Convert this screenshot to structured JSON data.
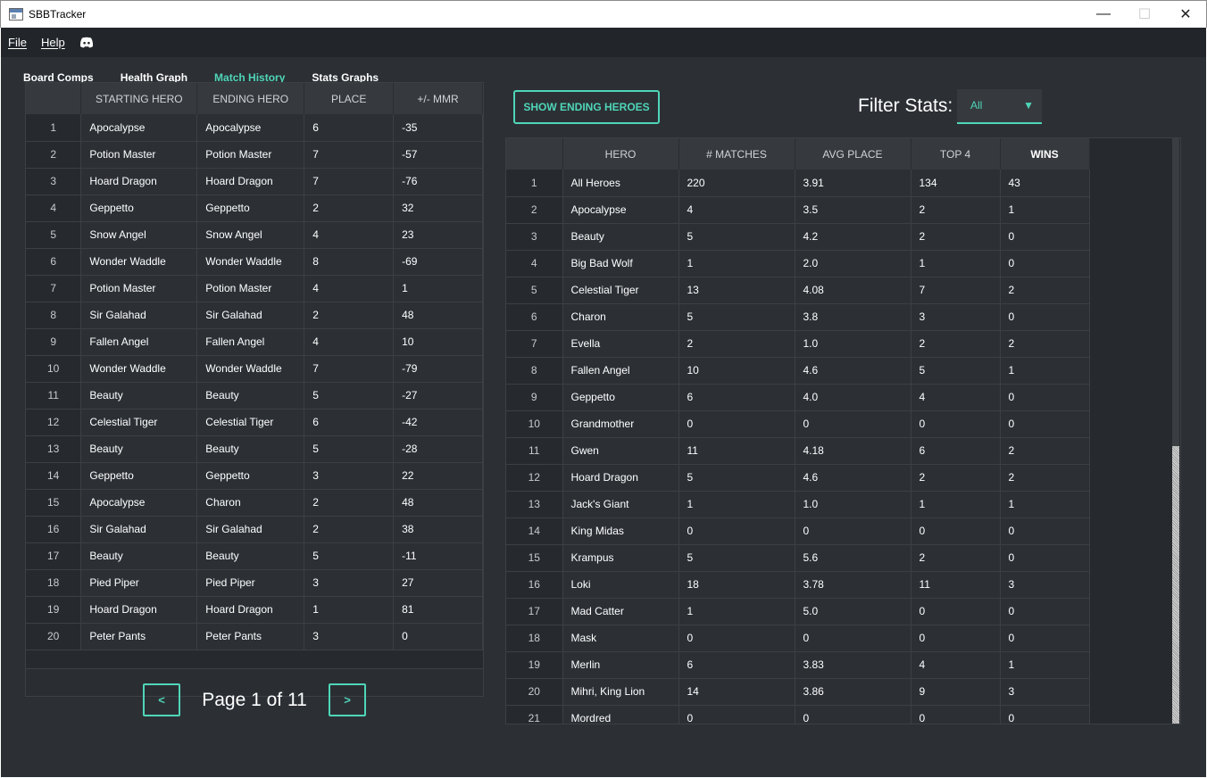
{
  "window": {
    "title": "SBBTracker",
    "min": "—",
    "max": "☐",
    "close": "✕"
  },
  "menu": {
    "file": "File",
    "help": "Help"
  },
  "tabs": [
    "Board Comps",
    "Health Graph",
    "Match History",
    "Stats Graphs"
  ],
  "match_history": {
    "columns": [
      "STARTING HERO",
      "ENDING HERO",
      "PLACE",
      "+/- MMR"
    ],
    "rows": [
      [
        "1",
        "Apocalypse",
        "Apocalypse",
        "6",
        "-35"
      ],
      [
        "2",
        "Potion Master",
        "Potion Master",
        "7",
        "-57"
      ],
      [
        "3",
        "Hoard Dragon",
        "Hoard Dragon",
        "7",
        "-76"
      ],
      [
        "4",
        "Geppetto",
        "Geppetto",
        "2",
        "32"
      ],
      [
        "5",
        "Snow Angel",
        "Snow Angel",
        "4",
        "23"
      ],
      [
        "6",
        "Wonder Waddle",
        "Wonder Waddle",
        "8",
        "-69"
      ],
      [
        "7",
        "Potion Master",
        "Potion Master",
        "4",
        "1"
      ],
      [
        "8",
        "Sir Galahad",
        "Sir Galahad",
        "2",
        "48"
      ],
      [
        "9",
        "Fallen Angel",
        "Fallen Angel",
        "4",
        "10"
      ],
      [
        "10",
        "Wonder Waddle",
        "Wonder Waddle",
        "7",
        "-79"
      ],
      [
        "11",
        "Beauty",
        "Beauty",
        "5",
        "-27"
      ],
      [
        "12",
        "Celestial Tiger",
        "Celestial Tiger",
        "6",
        "-42"
      ],
      [
        "13",
        "Beauty",
        "Beauty",
        "5",
        "-28"
      ],
      [
        "14",
        "Geppetto",
        "Geppetto",
        "3",
        "22"
      ],
      [
        "15",
        "Apocalypse",
        "Charon",
        "2",
        "48"
      ],
      [
        "16",
        "Sir Galahad",
        "Sir Galahad",
        "2",
        "38"
      ],
      [
        "17",
        "Beauty",
        "Beauty",
        "5",
        "-11"
      ],
      [
        "18",
        "Pied Piper",
        "Pied Piper",
        "3",
        "27"
      ],
      [
        "19",
        "Hoard Dragon",
        "Hoard Dragon",
        "1",
        "81"
      ],
      [
        "20",
        "Peter Pants",
        "Peter Pants",
        "3",
        "0"
      ]
    ]
  },
  "pager": {
    "prev": "<",
    "next": ">",
    "label": "Page 1 of 11"
  },
  "show_ending_button": "SHOW ENDING HEROES",
  "filter": {
    "label": "Filter Stats:",
    "selected": "All"
  },
  "hero_stats": {
    "columns": [
      "HERO",
      "# MATCHES",
      "AVG PLACE",
      "TOP 4",
      "WINS"
    ],
    "rows": [
      [
        "1",
        "All Heroes",
        "220",
        "3.91",
        "134",
        "43"
      ],
      [
        "2",
        "Apocalypse",
        "4",
        "3.5",
        "2",
        "1"
      ],
      [
        "3",
        "Beauty",
        "5",
        "4.2",
        "2",
        "0"
      ],
      [
        "4",
        "Big Bad Wolf",
        "1",
        "2.0",
        "1",
        "0"
      ],
      [
        "5",
        "Celestial Tiger",
        "13",
        "4.08",
        "7",
        "2"
      ],
      [
        "6",
        "Charon",
        "5",
        "3.8",
        "3",
        "0"
      ],
      [
        "7",
        "Evella",
        "2",
        "1.0",
        "2",
        "2"
      ],
      [
        "8",
        "Fallen Angel",
        "10",
        "4.6",
        "5",
        "1"
      ],
      [
        "9",
        "Geppetto",
        "6",
        "4.0",
        "4",
        "0"
      ],
      [
        "10",
        "Grandmother",
        "0",
        "0",
        "0",
        "0"
      ],
      [
        "11",
        "Gwen",
        "11",
        "4.18",
        "6",
        "2"
      ],
      [
        "12",
        "Hoard Dragon",
        "5",
        "4.6",
        "2",
        "2"
      ],
      [
        "13",
        "Jack's Giant",
        "1",
        "1.0",
        "1",
        "1"
      ],
      [
        "14",
        "King Midas",
        "0",
        "0",
        "0",
        "0"
      ],
      [
        "15",
        "Krampus",
        "5",
        "5.6",
        "2",
        "0"
      ],
      [
        "16",
        "Loki",
        "18",
        "3.78",
        "11",
        "3"
      ],
      [
        "17",
        "Mad Catter",
        "1",
        "5.0",
        "0",
        "0"
      ],
      [
        "18",
        "Mask",
        "0",
        "0",
        "0",
        "0"
      ],
      [
        "19",
        "Merlin",
        "6",
        "3.83",
        "4",
        "1"
      ],
      [
        "20",
        "Mihri, King Lion",
        "14",
        "3.86",
        "9",
        "3"
      ],
      [
        "21",
        "Mordred",
        "0",
        "0",
        "0",
        "0"
      ]
    ]
  },
  "colors": {
    "accent": "#4fd6b8",
    "background": "#2c3035",
    "menubar": "#22262a"
  }
}
